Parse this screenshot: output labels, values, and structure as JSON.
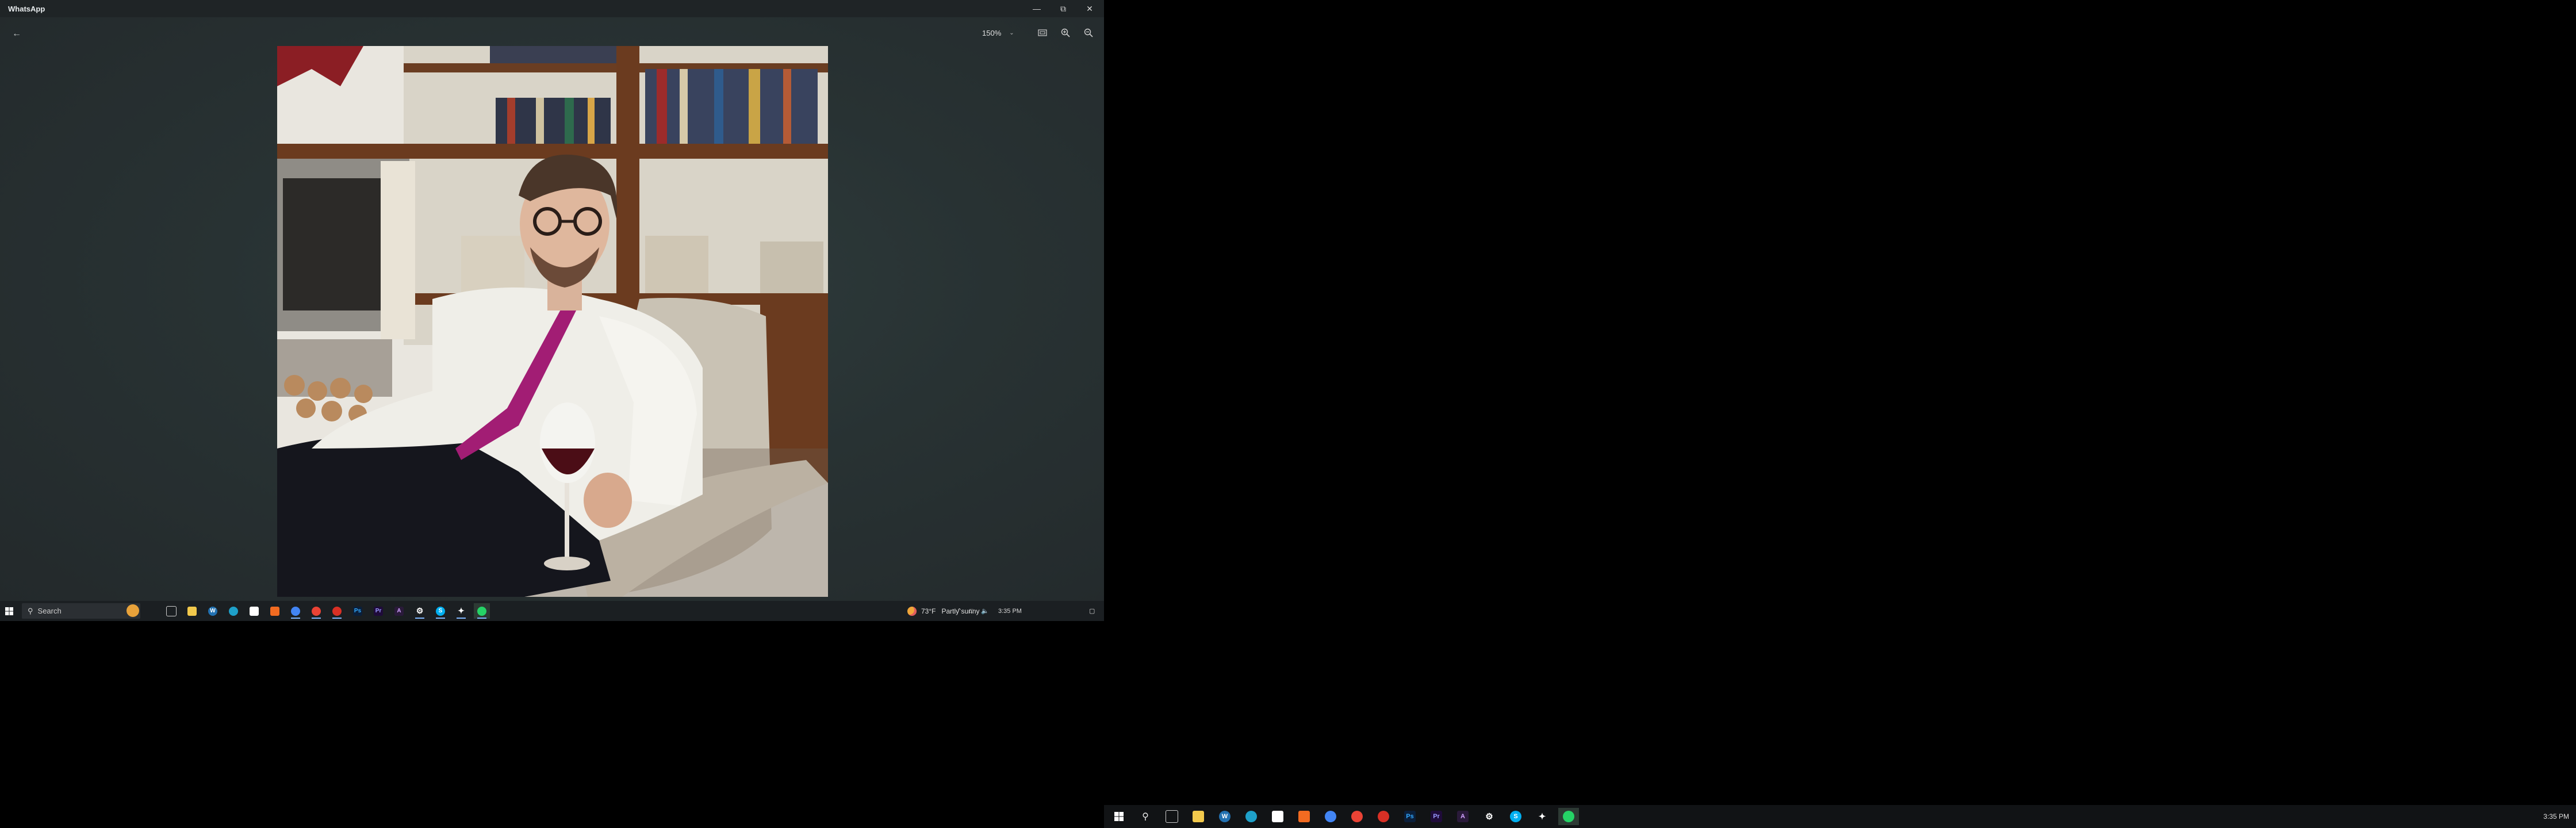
{
  "window": {
    "title": "WhatsApp",
    "minimize_icon": "minimize-icon",
    "restore_icon": "restore-icon",
    "close_icon": "close-icon"
  },
  "viewer": {
    "back_icon": "back-arrow-icon",
    "zoom_level": "150%",
    "tools": [
      "fit-to-window-icon",
      "zoom-in-icon",
      "zoom-out-icon"
    ],
    "image_description_icon": "photo"
  },
  "taskbar": {
    "search_placeholder": "Search",
    "weather_temp": "73°F",
    "weather_text": "Partly sunny",
    "time": "3:35 PM"
  },
  "taskbar2": {
    "time": "3:35 PM"
  },
  "colors": {
    "titlebar": "#1f2426",
    "viewer_bg": "#283233",
    "taskbar": "#1b1f22",
    "whatsapp_green": "#25d366"
  }
}
